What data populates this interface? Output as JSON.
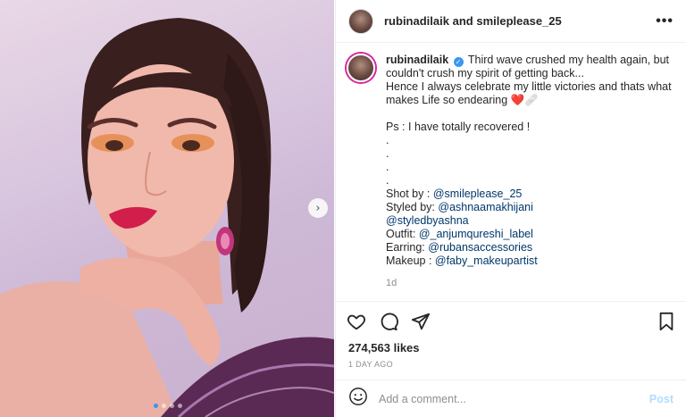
{
  "header": {
    "username": "rubinadilaik",
    "connector": "and",
    "collaborator": "smileplease_25",
    "more_icon": "more-horizontal-icon"
  },
  "caption": {
    "username": "rubinadilaik",
    "verified": "✓",
    "line1": "Third wave crushed my health again, but couldn't crush my spirit of getting back...",
    "line2": "Hence I always celebrate my little victories and thats what makes Life so endearing",
    "emoji": "❤️🩹",
    "ps": "Ps : I have totally recovered !",
    "dot": ".",
    "credits": [
      {
        "label": "Shot by : ",
        "mention": "@smileplease_25"
      },
      {
        "label": "Styled by: ",
        "mention": "@ashnaamakhijani"
      },
      {
        "label": "",
        "mention": "@styledbyashna"
      },
      {
        "label": "Outfit: ",
        "mention": "@_anjumqureshi_label"
      },
      {
        "label": "Earring: ",
        "mention": "@rubansaccessories"
      },
      {
        "label": "Makeup : ",
        "mention": "@faby_makeupartist"
      }
    ],
    "time": "1d"
  },
  "actions": {
    "like_icon": "heart-icon",
    "comment_icon": "comment-icon",
    "share_icon": "share-icon",
    "save_icon": "bookmark-icon"
  },
  "likes": "274,563 likes",
  "date": "1 DAY AGO",
  "comment": {
    "placeholder": "Add a comment...",
    "value": "",
    "post_label": "Post",
    "emoji_icon": "emoji-icon"
  },
  "carousel": {
    "next_symbol": "›",
    "slide_count": 4,
    "active_slide": 1
  },
  "colors": {
    "accent": "#3897f0",
    "mention": "#00376b",
    "muted": "#8e8e8e",
    "post_disabled": "#b3dbff"
  }
}
